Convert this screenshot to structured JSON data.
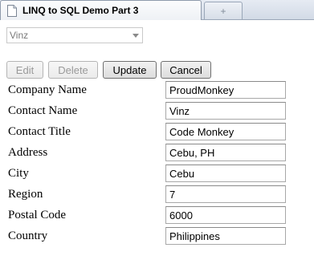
{
  "browser": {
    "tab_title": "LINQ to SQL Demo Part 3",
    "new_tab_symbol": "+"
  },
  "selector": {
    "selected_value": "Vinz"
  },
  "buttons": {
    "edit_label": "Edit",
    "delete_label": "Delete",
    "update_label": "Update",
    "cancel_label": "Cancel"
  },
  "form": {
    "fields": [
      {
        "label": "Company Name",
        "value": "ProudMonkey"
      },
      {
        "label": "Contact Name",
        "value": "Vinz"
      },
      {
        "label": "Contact Title",
        "value": "Code Monkey"
      },
      {
        "label": "Address",
        "value": "Cebu, PH"
      },
      {
        "label": "City",
        "value": "Cebu"
      },
      {
        "label": "Region",
        "value": "7"
      },
      {
        "label": "Postal Code",
        "value": "6000"
      },
      {
        "label": "Country",
        "value": "Philippines"
      }
    ]
  }
}
